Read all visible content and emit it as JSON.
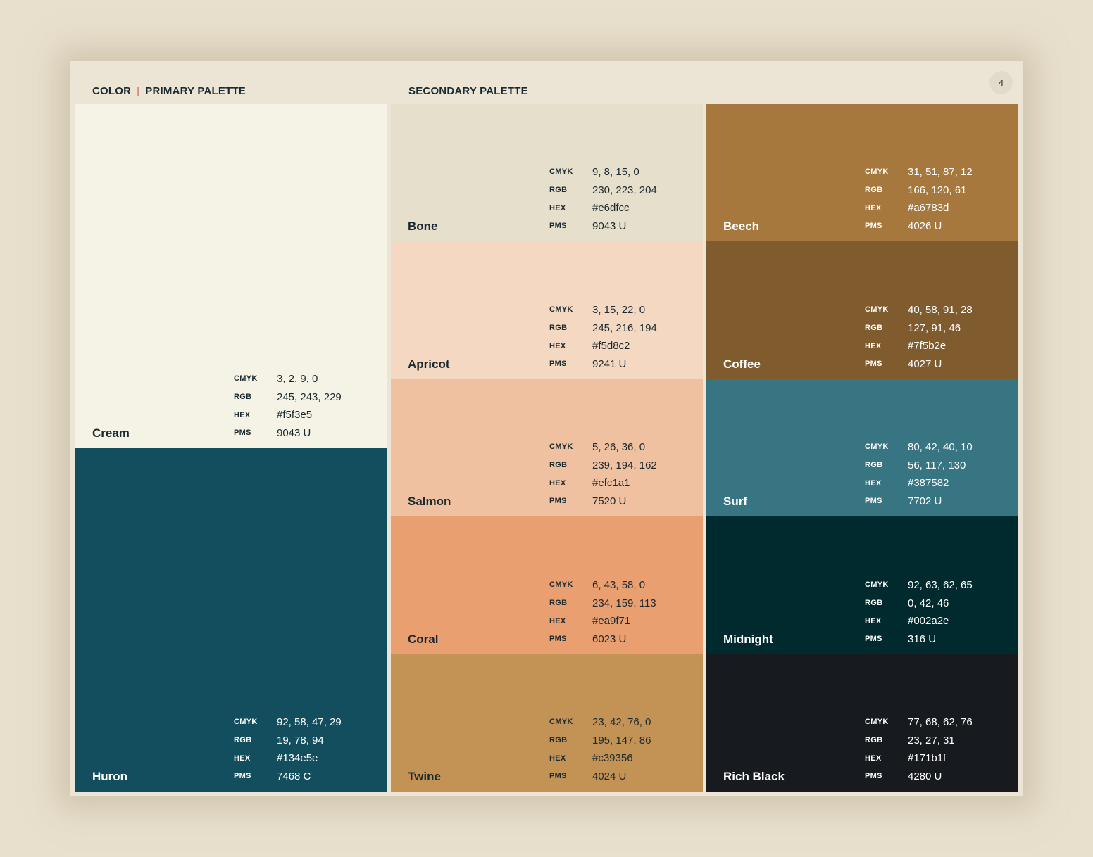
{
  "header": {
    "section": "COLOR",
    "primary_title": "PRIMARY PALETTE",
    "secondary_title": "SECONDARY PALETTE",
    "page_number": "4"
  },
  "spec_labels": {
    "cmyk": "CMYK",
    "rgb": "RGB",
    "hex": "HEX",
    "pms": "PMS"
  },
  "primary": [
    {
      "name": "Cream",
      "cmyk": "3, 2, 9, 0",
      "rgb": "245, 243, 229",
      "hex": "#f5f3e5",
      "pms": "9043 U",
      "color": "#f5f3e5"
    },
    {
      "name": "Huron",
      "cmyk": "92, 58, 47, 29",
      "rgb": "19, 78, 94",
      "hex": "#134e5e",
      "pms": "7468 C",
      "color": "#134e5e"
    }
  ],
  "secondary_left": [
    {
      "name": "Bone",
      "cmyk": "9, 8, 15, 0",
      "rgb": "230, 223, 204",
      "hex": "#e6dfcc",
      "pms": "9043 U",
      "color": "#e6dfcc"
    },
    {
      "name": "Apricot",
      "cmyk": "3, 15, 22, 0",
      "rgb": "245, 216, 194",
      "hex": "#f5d8c2",
      "pms": "9241 U",
      "color": "#f5d8c2"
    },
    {
      "name": "Salmon",
      "cmyk": "5, 26, 36, 0",
      "rgb": "239, 194, 162",
      "hex": "#efc1a1",
      "pms": "7520 U",
      "color": "#efc1a1"
    },
    {
      "name": "Coral",
      "cmyk": "6, 43, 58, 0",
      "rgb": "234, 159, 113",
      "hex": "#ea9f71",
      "pms": "6023 U",
      "color": "#ea9f71"
    },
    {
      "name": "Twine",
      "cmyk": "23, 42, 76, 0",
      "rgb": "195, 147, 86",
      "hex": "#c39356",
      "pms": "4024 U",
      "color": "#c39356"
    }
  ],
  "secondary_right": [
    {
      "name": "Beech",
      "cmyk": "31, 51, 87, 12",
      "rgb": "166, 120, 61",
      "hex": "#a6783d",
      "pms": "4026 U",
      "color": "#a6783d"
    },
    {
      "name": "Coffee",
      "cmyk": "40, 58, 91, 28",
      "rgb": "127, 91, 46",
      "hex": "#7f5b2e",
      "pms": "4027 U",
      "color": "#7f5b2e"
    },
    {
      "name": "Surf",
      "cmyk": "80, 42, 40, 10",
      "rgb": "56, 117, 130",
      "hex": "#387582",
      "pms": "7702 U",
      "color": "#387582"
    },
    {
      "name": "Midnight",
      "cmyk": "92, 63, 62, 65",
      "rgb": "0, 42, 46",
      "hex": "#002a2e",
      "pms": "316 U",
      "color": "#002a2e"
    },
    {
      "name": "Rich Black",
      "cmyk": "77, 68, 62, 76",
      "rgb": "23, 27, 31",
      "hex": "#171b1f",
      "pms": "4280 U",
      "color": "#171b1f"
    }
  ]
}
